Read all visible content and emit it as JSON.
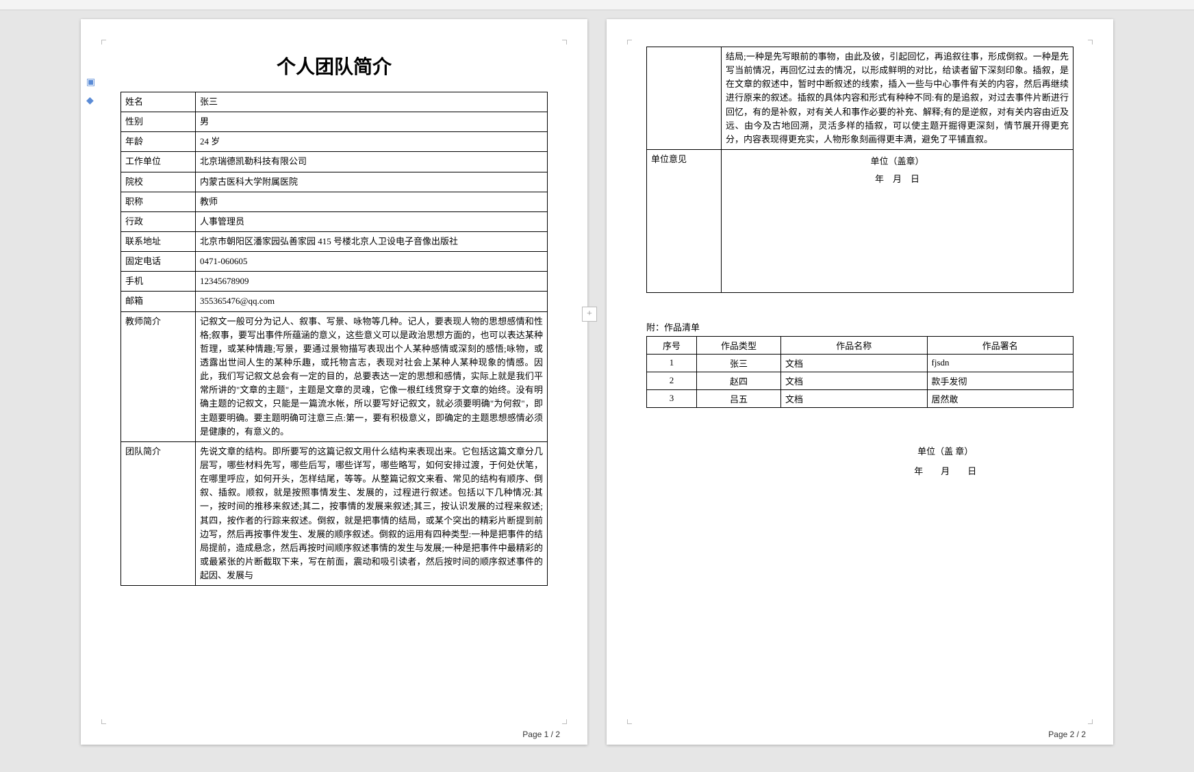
{
  "doc": {
    "title": "个人团队简介",
    "page1_label": "Page  1 / 2",
    "page2_label": "Page  2 / 2"
  },
  "info": {
    "name_label": "姓名",
    "name": "张三",
    "sex_label": "性别",
    "sex": "男",
    "age_label": "年龄",
    "age": "24 岁",
    "workunit_label": "工作单位",
    "workunit": "北京瑞德凯勒科技有限公司",
    "school_label": "院校",
    "school": "内蒙古医科大学附属医院",
    "title_label": "职称",
    "title": "教师",
    "admin_label": "行政",
    "admin": "人事管理员",
    "addr_label": "联系地址",
    "addr": "北京市朝阳区潘家园弘善家园 415 号楼北京人卫设电子音像出版社",
    "tel_label": "固定电话",
    "tel": "0471-060605",
    "mobile_label": "手机",
    "mobile": "12345678909",
    "mail_label": "邮箱",
    "mail": "355365476@qq.com",
    "teacher_label": "教师简介",
    "teacher": "记叙文一般可分为记人、叙事、写景、咏物等几种。记人，要表现人物的思想感情和性格;叙事，要写出事件所蕴涵的意义，这些意义可以是政治思想方面的，也可以表达某种哲理，或某种情趣;写景，要通过景物描写表现出个人某种感情或深刻的感悟;咏物，或透露出世间人生的某种乐趣，或托物言志，表现对社会上某种人某种现象的情感。因此，我们写记叙文总会有一定的目的，总要表达一定的思想和感情，实际上就是我们平常所讲的\"文章的主题\"，主题是文章的灵魂，它像一根红线贯穿于文章的始终。没有明确主题的记叙文，只能是一篇流水帐，所以要写好记叙文，就必须要明确\"为何叙\"，即主题要明确。要主题明确可注意三点:第一，要有积极意义，即确定的主题思想感情必须是健康的，有意义的。",
    "team_label": "团队简介",
    "team_p1": "先说文章的结构。即所要写的这篇记叙文用什么结构来表现出来。它包括这篇文章分几层写，哪些材料先写，哪些后写，哪些详写，哪些略写，如何安排过渡，于何处伏笔，在哪里呼应，如何开头，怎样结尾，等等。从整篇记叙文来看、常见的结构有顺序、倒叙、插叙。顺叙，就是按照事情发生、发展的，过程进行叙述。包括以下几种情况:其一，按时间的推移来叙述;其二，按事情的发展来叙述;其三，按认识发展的过程来叙述;其四，按作者的行踪来叙述。倒叙，就是把事情的结局，或某个突出的精彩片断提到前边写，然后再按事件发生、发展的顺序叙述。倒叙的运用有四种类型:一种是把事件的结局提前，造成悬念，然后再按时间顺序叙述事情的发生与发展;一种是把事件中最精彩的或最紧张的片断截取下来，写在前面，震动和吸引读者，然后按时间的顺序叙述事件的起因、发展与",
    "team_p2": "结局;一种是先写眼前的事物，由此及彼，引起回忆，再追叙往事，形成倒叙。一种是先写当前情况，再回忆过去的情况，以形成鲜明的对比，给读者留下深刻印象。插叙，是在文章的叙述中，暂时中断叙述的线索，插入一些与中心事件有关的内容，然后再继续进行原来的叙述。插叙的具体内容和形式有种种不同:有的是追叙，对过去事件片断进行回忆，有的是补叙，对有关人和事作必要的补充、解释;有的是逆叙，对有关内容由近及远、由今及古地回溯，灵活多样的插叙，可以使主题开掘得更深刻，情节展开得更充分，内容表现得更充实，人物形象刻画得更丰满，避免了平铺直叙。"
  },
  "opinion": {
    "label": "单位意见",
    "unit_stamp": "单位（盖章）",
    "date": "年　月　日"
  },
  "append": {
    "title": "附：作品清单",
    "headers": {
      "idx": "序号",
      "type": "作品类型",
      "name": "作品名称",
      "sign": "作品署名"
    },
    "rows": [
      {
        "idx": "1",
        "type": "张三",
        "name": "文档",
        "sign": "fjsdn"
      },
      {
        "idx": "2",
        "type": "赵四",
        "name": "文档",
        "sign": "款手发彻"
      },
      {
        "idx": "3",
        "type": "吕五",
        "name": "文档",
        "sign": "居然敢"
      }
    ],
    "unit_stamp": "单位（盖 章）",
    "date": "年　　月　　日"
  }
}
